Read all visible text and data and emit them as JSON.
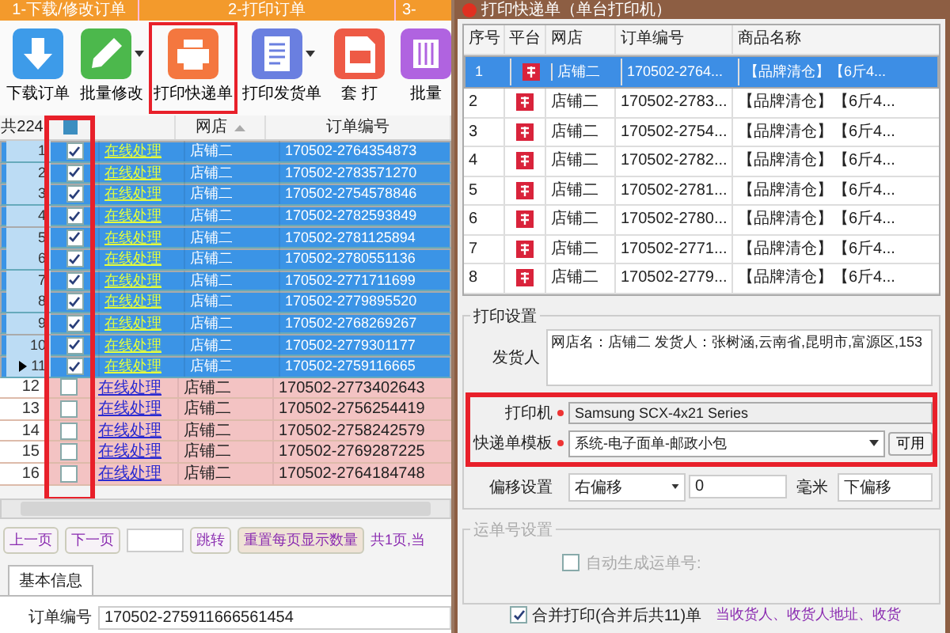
{
  "left_tabs": [
    {
      "label": "1-下载/修改订单"
    },
    {
      "label": "2-打印订单"
    },
    {
      "label": "3-"
    }
  ],
  "toolbar": [
    {
      "label": "下载订单",
      "kind": "download",
      "dropdown": false,
      "highlighted": false
    },
    {
      "label": "批量修改",
      "kind": "pencil",
      "dropdown": true,
      "highlighted": false
    },
    {
      "label": "打印快递单",
      "kind": "printer",
      "dropdown": false,
      "highlighted": true
    },
    {
      "label": "打印发货单",
      "kind": "document",
      "dropdown": true,
      "highlighted": false
    },
    {
      "label": "套 打",
      "kind": "printdoc",
      "dropdown": false,
      "highlighted": false
    },
    {
      "label": "批量",
      "kind": "columns",
      "dropdown": false,
      "highlighted": false
    }
  ],
  "grid": {
    "count_label": "共224",
    "checkbox_column_highlighted": true,
    "columns": [
      {
        "label": "网店",
        "sorted": true
      },
      {
        "label": "订单编号",
        "sorted": false
      }
    ],
    "rows": [
      {
        "number": "1",
        "checked": true,
        "selected": true,
        "current": false,
        "status": "在线处理",
        "shop": "店铺二",
        "order": "170502-2764354873"
      },
      {
        "number": "2",
        "checked": true,
        "selected": true,
        "current": false,
        "status": "在线处理",
        "shop": "店铺二",
        "order": "170502-2783571270"
      },
      {
        "number": "3",
        "checked": true,
        "selected": true,
        "current": false,
        "status": "在线处理",
        "shop": "店铺二",
        "order": "170502-2754578846"
      },
      {
        "number": "4",
        "checked": true,
        "selected": true,
        "current": false,
        "status": "在线处理",
        "shop": "店铺二",
        "order": "170502-2782593849"
      },
      {
        "number": "5",
        "checked": true,
        "selected": true,
        "current": false,
        "status": "在线处理",
        "shop": "店铺二",
        "order": "170502-2781125894"
      },
      {
        "number": "6",
        "checked": true,
        "selected": true,
        "current": false,
        "status": "在线处理",
        "shop": "店铺二",
        "order": "170502-2780551136"
      },
      {
        "number": "7",
        "checked": true,
        "selected": true,
        "current": false,
        "status": "在线处理",
        "shop": "店铺二",
        "order": "170502-2771711699"
      },
      {
        "number": "8",
        "checked": true,
        "selected": true,
        "current": false,
        "status": "在线处理",
        "shop": "店铺二",
        "order": "170502-2779895520"
      },
      {
        "number": "9",
        "checked": true,
        "selected": true,
        "current": false,
        "status": "在线处理",
        "shop": "店铺二",
        "order": "170502-2768269267"
      },
      {
        "number": "10",
        "checked": true,
        "selected": true,
        "current": false,
        "status": "在线处理",
        "shop": "店铺二",
        "order": "170502-2779301177"
      },
      {
        "number": "11",
        "checked": true,
        "selected": true,
        "current": true,
        "status": "在线处理",
        "shop": "店铺二",
        "order": "170502-2759116665"
      },
      {
        "number": "12",
        "checked": false,
        "selected": false,
        "current": false,
        "status": "在线处理",
        "shop": "店铺二",
        "order": "170502-2773402643"
      },
      {
        "number": "13",
        "checked": false,
        "selected": false,
        "current": false,
        "status": "在线处理",
        "shop": "店铺二",
        "order": "170502-2756254419"
      },
      {
        "number": "14",
        "checked": false,
        "selected": false,
        "current": false,
        "status": "在线处理",
        "shop": "店铺二",
        "order": "170502-2758242579"
      },
      {
        "number": "15",
        "checked": false,
        "selected": false,
        "current": false,
        "status": "在线处理",
        "shop": "店铺二",
        "order": "170502-2769287225"
      },
      {
        "number": "16",
        "checked": false,
        "selected": false,
        "current": false,
        "status": "在线处理",
        "shop": "店铺二",
        "order": "170502-2764184748"
      }
    ]
  },
  "pager": {
    "prev": "上一页",
    "next": "下一页",
    "jump": "跳转",
    "reset": "重置每页显示数量",
    "info": "共1页,当"
  },
  "detail_tabs": [
    {
      "label": "基本信息",
      "selected": true
    }
  ],
  "detail": {
    "label": "订单编号",
    "value": "170502-275911666561454"
  },
  "dialog": {
    "title": "打印快递单（单台打印机）",
    "columns": [
      "序号",
      "平台",
      "网店",
      "订单编号",
      "商品名称"
    ],
    "rows": [
      {
        "number": "1",
        "shop": "店铺二",
        "order": "170502-2764...",
        "goods": "【品牌清仓】【6斤4...",
        "selected": true
      },
      {
        "number": "2",
        "shop": "店铺二",
        "order": "170502-2783...",
        "goods": "【品牌清仓】【6斤4...",
        "selected": false
      },
      {
        "number": "3",
        "shop": "店铺二",
        "order": "170502-2754...",
        "goods": "【品牌清仓】【6斤4...",
        "selected": false
      },
      {
        "number": "4",
        "shop": "店铺二",
        "order": "170502-2782...",
        "goods": "【品牌清仓】【6斤4...",
        "selected": false
      },
      {
        "number": "5",
        "shop": "店铺二",
        "order": "170502-2781...",
        "goods": "【品牌清仓】【6斤4...",
        "selected": false
      },
      {
        "number": "6",
        "shop": "店铺二",
        "order": "170502-2780...",
        "goods": "【品牌清仓】【6斤4...",
        "selected": false
      },
      {
        "number": "7",
        "shop": "店铺二",
        "order": "170502-2771...",
        "goods": "【品牌清仓】【6斤4...",
        "selected": false
      },
      {
        "number": "8",
        "shop": "店铺二",
        "order": "170502-2779...",
        "goods": "【品牌清仓】【6斤4...",
        "selected": false
      }
    ],
    "settings": {
      "title": "打印设置",
      "sender_label": "发货人",
      "sender_value": "网店名：店铺二 发货人：张树涵,云南省,昆明市,富源区,153",
      "printer_section_highlighted": true,
      "printer_label": "打印机",
      "printer_required": true,
      "printer_value": "Samsung SCX-4x21 Series",
      "template_label": "快递单模板",
      "template_required": true,
      "template_value": "系统-电子面单-邮政小包",
      "template_button": "可用",
      "offset_label": "偏移设置",
      "offset_x": "右偏移",
      "offset_value": "0",
      "offset_unit": "毫米",
      "offset_y": "下偏移"
    },
    "waybill": {
      "title": "运单号设置",
      "auto_label": "自动生成运单号:",
      "auto_checked": false,
      "disabled": true
    },
    "merge": {
      "label": "合并打印(合并后共11)单",
      "checked": true,
      "note": "当收货人、收货人地址、收货"
    }
  }
}
